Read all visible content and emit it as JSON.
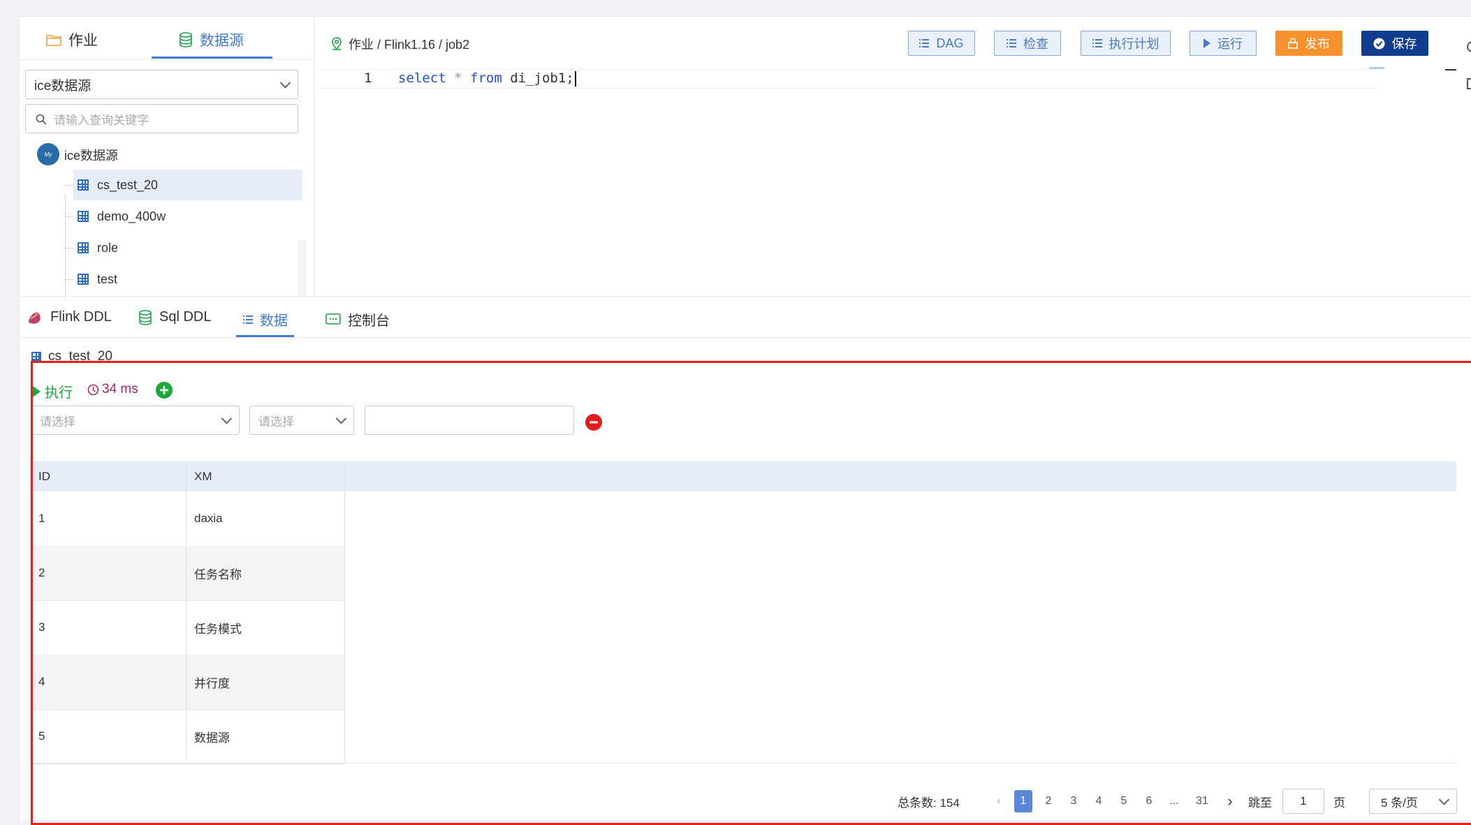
{
  "left_panel": {
    "tabs": [
      {
        "label": "作业",
        "icon": "folder-icon"
      },
      {
        "label": "数据源",
        "icon": "database-icon"
      }
    ],
    "datasource_select": "ice数据源",
    "search_placeholder": "请输入查询关键字",
    "tree_root": "ice数据源",
    "tree_root_icon": "My",
    "tables": [
      "cs_test_20",
      "demo_400w",
      "role",
      "test"
    ]
  },
  "editor": {
    "breadcrumb": "作业 / Flink1.16 / job2",
    "toolbar": {
      "dag": "DAG",
      "check": "检查",
      "plan": "执行计划",
      "run": "运行",
      "publish": "发布",
      "save": "保存"
    },
    "line_number": "1",
    "code": {
      "select": "select",
      "star": "*",
      "from": "from",
      "rest": "di_job1;"
    }
  },
  "bottom_tabs": [
    "Flink DDL",
    "Sql DDL",
    "数据",
    "控制台"
  ],
  "data_panel": {
    "table_name": "cs_test_20",
    "execute_label": "执行",
    "time": "34 ms",
    "filter_field_placeholder": "请选择",
    "filter_op_placeholder": "请选择",
    "filter_value": "",
    "columns": [
      "ID",
      "XM"
    ],
    "rows": [
      [
        "1",
        "daxia"
      ],
      [
        "2",
        "任务名称"
      ],
      [
        "3",
        "任务模式"
      ],
      [
        "4",
        "并行度"
      ],
      [
        "5",
        "数据源"
      ]
    ],
    "pagination": {
      "total_label": "总条数:",
      "total": "154",
      "pages": [
        "1",
        "2",
        "3",
        "4",
        "5",
        "6",
        "...",
        "31"
      ],
      "current": "1",
      "goto_label": "跳至",
      "goto_value": "1",
      "page_suffix": "页",
      "page_size": "5 条/页"
    }
  },
  "colors": {
    "accent": "#3e7cd8",
    "highlight_frame": "#ea1c1c",
    "publish": "#f6912d",
    "save": "#0f3c8c",
    "execute_green": "#1aaa3a",
    "time_magenta": "#b0246a"
  }
}
